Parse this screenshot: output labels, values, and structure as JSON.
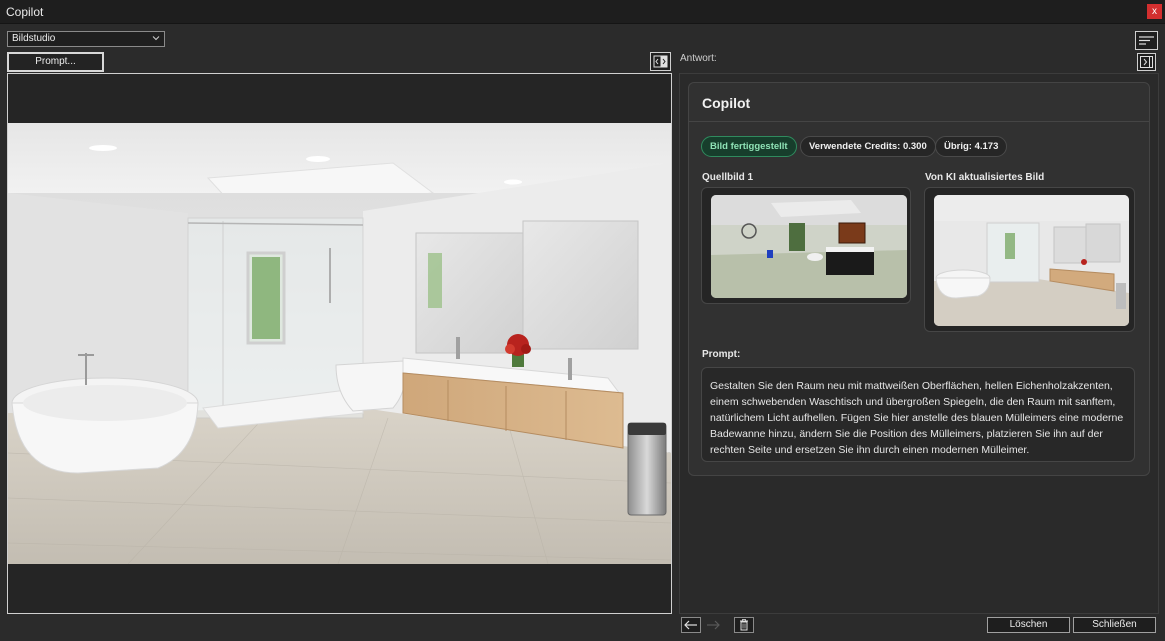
{
  "window": {
    "title": "Copilot",
    "close_label": "x"
  },
  "toolbar": {
    "mode_select_value": "Bildstudio",
    "prompt_button_label": "Prompt..."
  },
  "response": {
    "label": "Antwort:",
    "card_title": "Copilot",
    "status_chip": "Bild fertiggestellt",
    "credits_chip": "Verwendete Credits: 0.300",
    "remaining_chip": "Übrig: 4.173",
    "source_label": "Quellbild 1",
    "ai_label": "Von KI aktualisiertes Bild",
    "prompt_label": "Prompt:",
    "prompt_text": "Gestalten Sie den Raum neu mit mattweißen Oberflächen, hellen Eichenholzakzenten, einem schwebenden Waschtisch und übergroßen Spiegeln, die den Raum mit sanftem, natürlichem Licht aufhellen. Fügen Sie hier anstelle des blauen Mülleimers eine moderne Badewanne hinzu, ändern Sie die Position des Mülleimers, platzieren Sie ihn auf der rechten Seite und ersetzen Sie ihn durch einen modernen Mülleimer."
  },
  "footer": {
    "delete_label": "Löschen",
    "close_label": "Schließen"
  },
  "icons": {
    "compare": "split-view-icon",
    "sort": "sort-lines-icon",
    "collapse": "collapse-right-icon",
    "back": "arrow-left-icon",
    "forward": "arrow-right-icon",
    "trash": "trash-icon"
  },
  "colors": {
    "background": "#2b2b2b",
    "status_chip_bg": "#173e2c",
    "status_chip_text": "#8fe2b6",
    "close_button": "#d32f2f"
  }
}
